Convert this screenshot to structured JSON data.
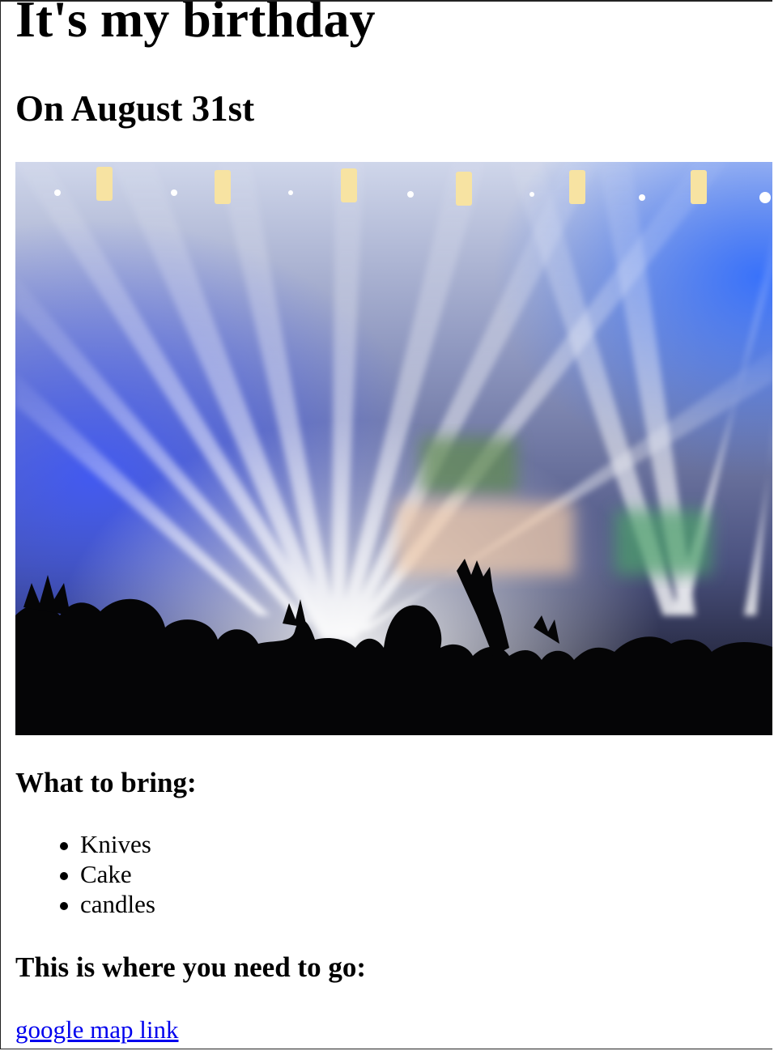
{
  "page": {
    "title": "It's my birthday",
    "subtitle": "On August 31st"
  },
  "hero_image": {
    "icon": "concert-crowd-lights-photo"
  },
  "bring": {
    "heading": "What to bring:",
    "items": [
      "Knives",
      "Cake",
      "candles"
    ]
  },
  "location": {
    "heading": "This is where you need to go:",
    "link_text": "google map link"
  },
  "colors": {
    "link": "#0000ee",
    "text": "#000000",
    "background": "#ffffff"
  }
}
